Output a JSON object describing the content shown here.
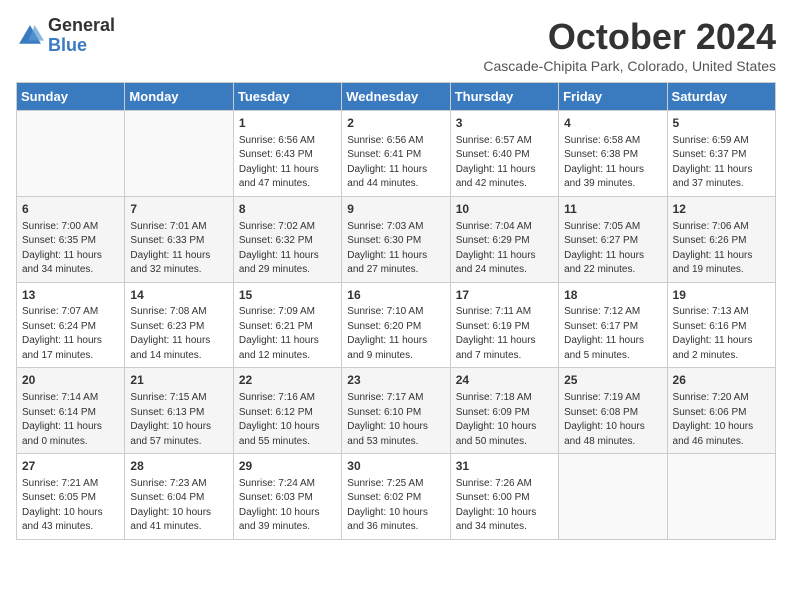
{
  "header": {
    "logo_general": "General",
    "logo_blue": "Blue",
    "month_title": "October 2024",
    "subtitle": "Cascade-Chipita Park, Colorado, United States"
  },
  "days_of_week": [
    "Sunday",
    "Monday",
    "Tuesday",
    "Wednesday",
    "Thursday",
    "Friday",
    "Saturday"
  ],
  "weeks": [
    [
      {
        "day": "",
        "info": ""
      },
      {
        "day": "",
        "info": ""
      },
      {
        "day": "1",
        "info": "Sunrise: 6:56 AM\nSunset: 6:43 PM\nDaylight: 11 hours and 47 minutes."
      },
      {
        "day": "2",
        "info": "Sunrise: 6:56 AM\nSunset: 6:41 PM\nDaylight: 11 hours and 44 minutes."
      },
      {
        "day": "3",
        "info": "Sunrise: 6:57 AM\nSunset: 6:40 PM\nDaylight: 11 hours and 42 minutes."
      },
      {
        "day": "4",
        "info": "Sunrise: 6:58 AM\nSunset: 6:38 PM\nDaylight: 11 hours and 39 minutes."
      },
      {
        "day": "5",
        "info": "Sunrise: 6:59 AM\nSunset: 6:37 PM\nDaylight: 11 hours and 37 minutes."
      }
    ],
    [
      {
        "day": "6",
        "info": "Sunrise: 7:00 AM\nSunset: 6:35 PM\nDaylight: 11 hours and 34 minutes."
      },
      {
        "day": "7",
        "info": "Sunrise: 7:01 AM\nSunset: 6:33 PM\nDaylight: 11 hours and 32 minutes."
      },
      {
        "day": "8",
        "info": "Sunrise: 7:02 AM\nSunset: 6:32 PM\nDaylight: 11 hours and 29 minutes."
      },
      {
        "day": "9",
        "info": "Sunrise: 7:03 AM\nSunset: 6:30 PM\nDaylight: 11 hours and 27 minutes."
      },
      {
        "day": "10",
        "info": "Sunrise: 7:04 AM\nSunset: 6:29 PM\nDaylight: 11 hours and 24 minutes."
      },
      {
        "day": "11",
        "info": "Sunrise: 7:05 AM\nSunset: 6:27 PM\nDaylight: 11 hours and 22 minutes."
      },
      {
        "day": "12",
        "info": "Sunrise: 7:06 AM\nSunset: 6:26 PM\nDaylight: 11 hours and 19 minutes."
      }
    ],
    [
      {
        "day": "13",
        "info": "Sunrise: 7:07 AM\nSunset: 6:24 PM\nDaylight: 11 hours and 17 minutes."
      },
      {
        "day": "14",
        "info": "Sunrise: 7:08 AM\nSunset: 6:23 PM\nDaylight: 11 hours and 14 minutes."
      },
      {
        "day": "15",
        "info": "Sunrise: 7:09 AM\nSunset: 6:21 PM\nDaylight: 11 hours and 12 minutes."
      },
      {
        "day": "16",
        "info": "Sunrise: 7:10 AM\nSunset: 6:20 PM\nDaylight: 11 hours and 9 minutes."
      },
      {
        "day": "17",
        "info": "Sunrise: 7:11 AM\nSunset: 6:19 PM\nDaylight: 11 hours and 7 minutes."
      },
      {
        "day": "18",
        "info": "Sunrise: 7:12 AM\nSunset: 6:17 PM\nDaylight: 11 hours and 5 minutes."
      },
      {
        "day": "19",
        "info": "Sunrise: 7:13 AM\nSunset: 6:16 PM\nDaylight: 11 hours and 2 minutes."
      }
    ],
    [
      {
        "day": "20",
        "info": "Sunrise: 7:14 AM\nSunset: 6:14 PM\nDaylight: 11 hours and 0 minutes."
      },
      {
        "day": "21",
        "info": "Sunrise: 7:15 AM\nSunset: 6:13 PM\nDaylight: 10 hours and 57 minutes."
      },
      {
        "day": "22",
        "info": "Sunrise: 7:16 AM\nSunset: 6:12 PM\nDaylight: 10 hours and 55 minutes."
      },
      {
        "day": "23",
        "info": "Sunrise: 7:17 AM\nSunset: 6:10 PM\nDaylight: 10 hours and 53 minutes."
      },
      {
        "day": "24",
        "info": "Sunrise: 7:18 AM\nSunset: 6:09 PM\nDaylight: 10 hours and 50 minutes."
      },
      {
        "day": "25",
        "info": "Sunrise: 7:19 AM\nSunset: 6:08 PM\nDaylight: 10 hours and 48 minutes."
      },
      {
        "day": "26",
        "info": "Sunrise: 7:20 AM\nSunset: 6:06 PM\nDaylight: 10 hours and 46 minutes."
      }
    ],
    [
      {
        "day": "27",
        "info": "Sunrise: 7:21 AM\nSunset: 6:05 PM\nDaylight: 10 hours and 43 minutes."
      },
      {
        "day": "28",
        "info": "Sunrise: 7:23 AM\nSunset: 6:04 PM\nDaylight: 10 hours and 41 minutes."
      },
      {
        "day": "29",
        "info": "Sunrise: 7:24 AM\nSunset: 6:03 PM\nDaylight: 10 hours and 39 minutes."
      },
      {
        "day": "30",
        "info": "Sunrise: 7:25 AM\nSunset: 6:02 PM\nDaylight: 10 hours and 36 minutes."
      },
      {
        "day": "31",
        "info": "Sunrise: 7:26 AM\nSunset: 6:00 PM\nDaylight: 10 hours and 34 minutes."
      },
      {
        "day": "",
        "info": ""
      },
      {
        "day": "",
        "info": ""
      }
    ]
  ]
}
